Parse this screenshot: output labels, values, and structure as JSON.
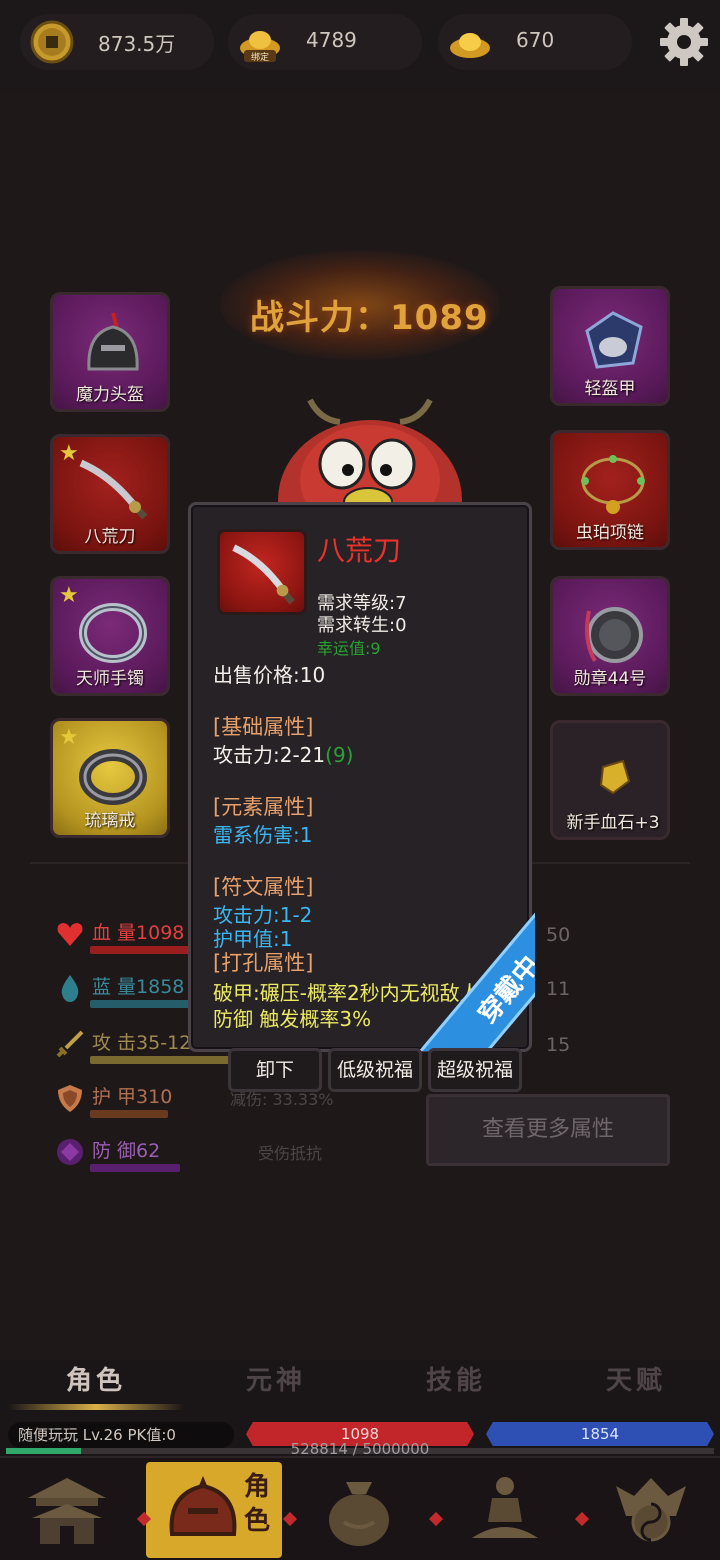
{
  "resources": {
    "coins": {
      "value": "873.5万",
      "icon": "copper-coin-icon"
    },
    "bound_ingot": {
      "value": "4789",
      "tag": "绑定",
      "icon": "bound-gold-ingot-icon"
    },
    "ingot": {
      "value": "670",
      "icon": "gold-ingot-icon"
    }
  },
  "combat_power": "战斗力：1089",
  "equipment": {
    "left": [
      {
        "label": "魔力头盔",
        "rarity": "purple",
        "starred": false,
        "icon": "helmet-icon"
      },
      {
        "label": "八荒刀",
        "rarity": "red",
        "starred": true,
        "icon": "blade-icon"
      },
      {
        "label": "天师手镯",
        "rarity": "purple",
        "starred": true,
        "icon": "bracelet-icon"
      },
      {
        "label": "琉璃戒",
        "rarity": "gold",
        "starred": true,
        "icon": "ring-icon"
      }
    ],
    "right": [
      {
        "label": "轻盔甲",
        "rarity": "purple",
        "starred": false,
        "icon": "light-armor-icon"
      },
      {
        "label": "虫珀项链",
        "rarity": "red",
        "starred": false,
        "icon": "necklace-icon"
      },
      {
        "label": "勋章44号",
        "rarity": "purple",
        "starred": false,
        "icon": "medal-icon"
      },
      {
        "label": "新手血石+3",
        "rarity": "dark",
        "starred": false,
        "icon": "bloodstone-icon"
      }
    ]
  },
  "stats": [
    {
      "label": "血 量1098",
      "right": "50",
      "icon": "heart-icon",
      "color": "#e03030"
    },
    {
      "label": "蓝 量1858",
      "right": "11",
      "icon": "mana-drop-icon",
      "color": "#2f7e8c"
    },
    {
      "label": "攻 击35-12",
      "right": "15",
      "icon": "sword-icon",
      "color": "#c2a045"
    },
    {
      "label": "护 甲310",
      "sub": "减伤: 33.33%",
      "icon": "shield-icon",
      "color": "#c87a4a"
    },
    {
      "label": "防 御62",
      "sub": "受伤抵抗",
      "icon": "defense-gem-icon",
      "color": "#8a3aa0"
    }
  ],
  "more_button": "查看更多属性",
  "tooltip": {
    "name": "八荒刀",
    "req_level": "需求等级:7",
    "req_rebirth": "需求转生:0",
    "luck": "幸运值:9",
    "sell_price": "出售价格:10",
    "base_header": "[基础属性]",
    "attack_text": "攻击力:2-21",
    "attack_bonus": "(9)",
    "element_header": "[元素属性]",
    "element_value": "雷系伤害:1",
    "rune_header": "[符文属性]",
    "rune_attack": "攻击力:1-2",
    "rune_armor": "护甲值:1",
    "socket_header": "[打孔属性]",
    "socket_line1": "破甲:碾压-概率2秒内无视敌人",
    "socket_line2": "防御  触发概率3%",
    "ribbon": "穿戴中",
    "buttons": [
      "卸下",
      "低级祝福",
      "超级祝福"
    ]
  },
  "tabs": [
    "角色",
    "元神",
    "技能",
    "天赋"
  ],
  "active_tab": "角色",
  "player": {
    "info": "随便玩玩  Lv.26 PK值:0",
    "hp": "1098",
    "mp": "1854",
    "xp": "528814 / 5000000",
    "xp_fraction": 0.106
  },
  "bottom_nav": [
    {
      "icon": "palace-icon",
      "active": false
    },
    {
      "icon": "warrior-helmet-icon",
      "active": true,
      "label": "角色"
    },
    {
      "icon": "money-bag-icon",
      "active": false
    },
    {
      "icon": "meditation-icon",
      "active": false
    },
    {
      "icon": "taiji-guild-icon",
      "active": false
    }
  ],
  "settings_icon": "gear-icon"
}
